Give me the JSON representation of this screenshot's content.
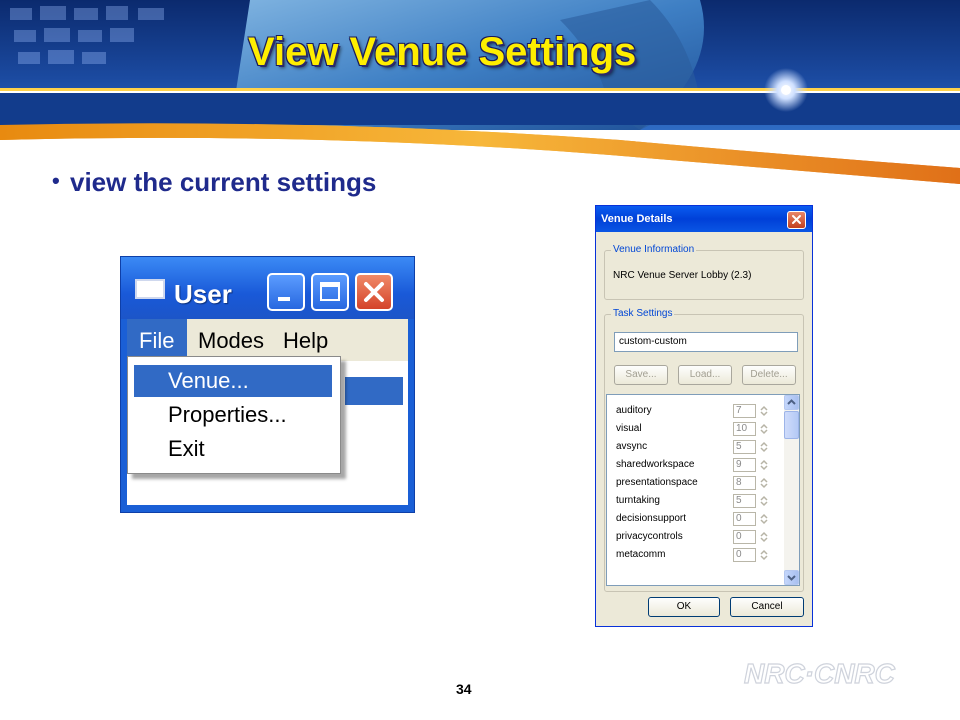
{
  "slide": {
    "title": "View Venue Settings",
    "bullet": "view the current settings",
    "page_number": "34",
    "logo_text": "NRC·CNRC"
  },
  "user_window": {
    "title": "User",
    "menus": [
      "File",
      "Modes",
      "Help"
    ],
    "file_menu_items": [
      "Venue...",
      "Properties...",
      "Exit"
    ]
  },
  "venue_dialog": {
    "title": "Venue Details",
    "venue_information": {
      "label": "Venue Information",
      "value": "NRC Venue Server Lobby (2.3)"
    },
    "task_settings": {
      "label": "Task Settings",
      "input_value": "custom-custom",
      "buttons": [
        "Save...",
        "Load...",
        "Delete..."
      ]
    },
    "settings": [
      {
        "name": "auditory",
        "value": "7"
      },
      {
        "name": "visual",
        "value": "10"
      },
      {
        "name": "avsync",
        "value": "5"
      },
      {
        "name": "sharedworkspace",
        "value": "9"
      },
      {
        "name": "presentationspace",
        "value": "8"
      },
      {
        "name": "turntaking",
        "value": "5"
      },
      {
        "name": "decisionsupport",
        "value": "0"
      },
      {
        "name": "privacycontrols",
        "value": "0"
      },
      {
        "name": "metacomm",
        "value": "0"
      }
    ],
    "ok_label": "OK",
    "cancel_label": "Cancel"
  },
  "colors": {
    "title_yellow": "#ffee00",
    "bullet_blue": "#1f2a8c",
    "xp_blue": "#316ac5",
    "banner_orange": "#f0a020"
  }
}
